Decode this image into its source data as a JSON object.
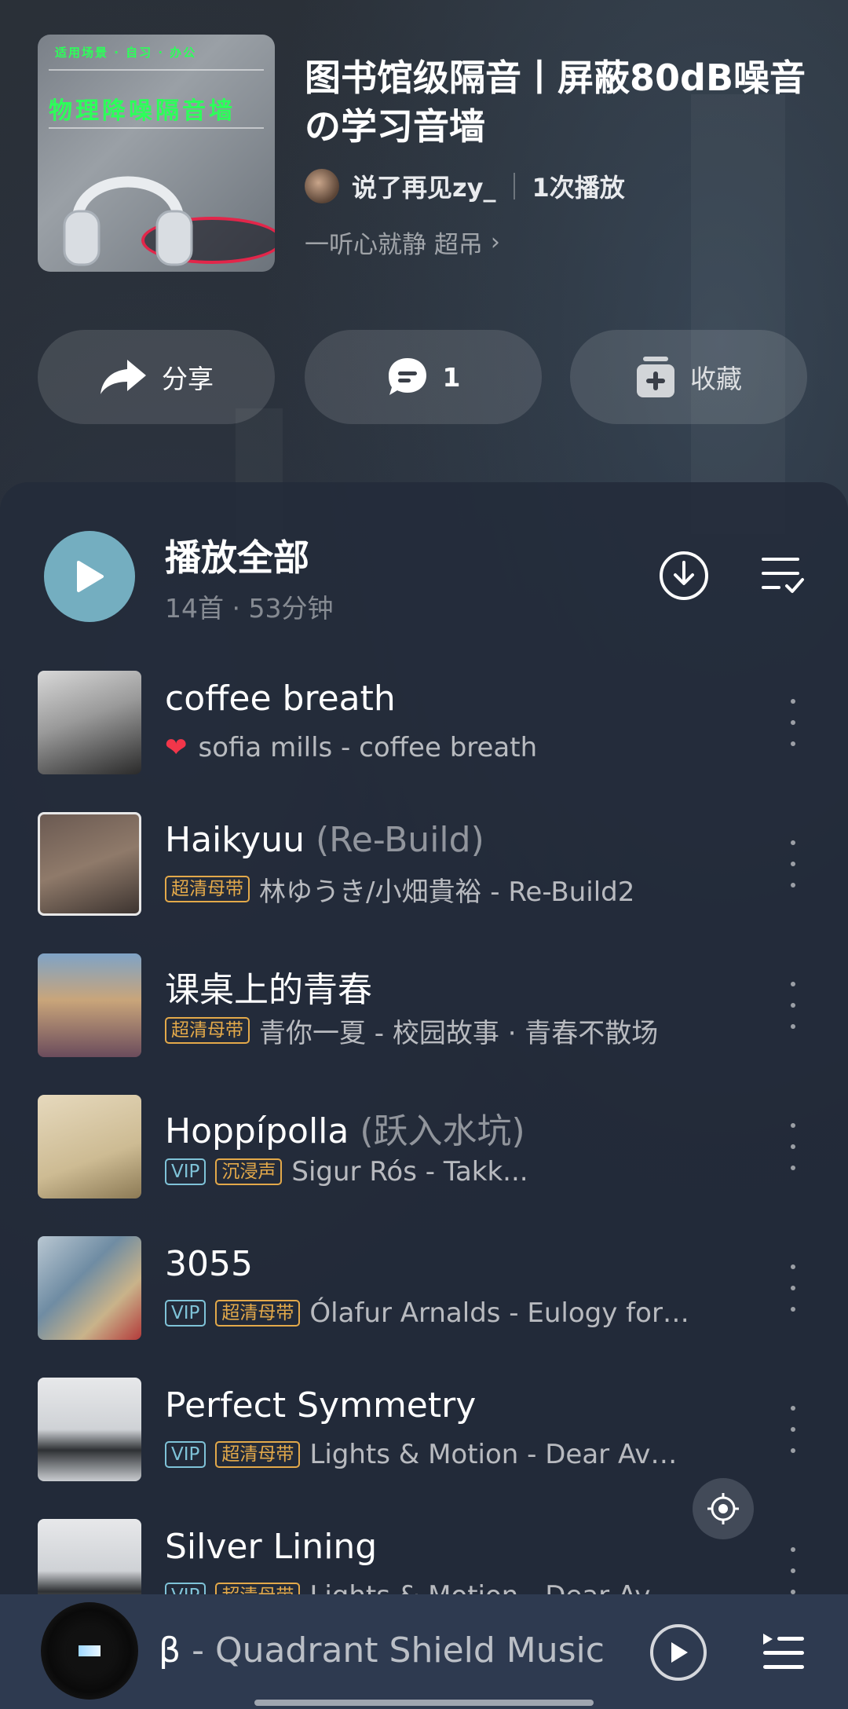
{
  "header": {
    "cover": {
      "line1": "适用场景 · 自习 · 办公",
      "line2": "物理降噪隔音墙"
    },
    "title": "图书馆级隔音丨屏蔽80dB噪音の学习音墙",
    "author": "说了再见zy_",
    "plays": "1次播放",
    "description": "一听心就静 超吊",
    "description_chevron": "›"
  },
  "actions": {
    "share_label": "分享",
    "comment_count": "1",
    "favorite_label": "收藏"
  },
  "playlist": {
    "play_all_label": "播放全部",
    "meta": "14首 · 53分钟"
  },
  "songs": [
    {
      "name": "coffee breath",
      "sub": "",
      "tags": [],
      "liked": true,
      "meta": "sofia mills - coffee breath"
    },
    {
      "name": "Haikyuu ",
      "sub": "(Re-Build)",
      "tags": [
        "超清母带"
      ],
      "meta": "林ゆうき/小畑貴裕 - Re-Build2"
    },
    {
      "name": "课桌上的青春",
      "sub": "",
      "tags": [
        "超清母带"
      ],
      "meta": "青你一夏 - 校园故事 · 青春不散场"
    },
    {
      "name": "Hoppípolla ",
      "sub": "(跃入水坑)",
      "tags": [
        "VIP",
        "沉浸声"
      ],
      "meta": "Sigur Rós - Takk..."
    },
    {
      "name": "3055",
      "sub": "",
      "tags": [
        "VIP",
        "超清母带"
      ],
      "meta": "Ólafur Arnalds - Eulogy for…"
    },
    {
      "name": "Perfect Symmetry",
      "sub": "",
      "tags": [
        "VIP",
        "超清母带"
      ],
      "meta": "Lights & Motion - Dear Av…"
    },
    {
      "name": "Silver Lining",
      "sub": "",
      "tags": [
        "VIP",
        "超清母带"
      ],
      "meta": "Lights & Motion - Dear Av…"
    }
  ],
  "player": {
    "track": "β",
    "artist": " - Quadrant Shield Music"
  },
  "icons": {
    "share": "share-icon",
    "comment": "comment-icon",
    "favorite": "add-collection-icon",
    "download": "download-icon",
    "sort": "multi-select-icon",
    "more": "more-vertical-icon",
    "locate": "locate-current-icon",
    "queue": "queue-icon"
  },
  "colors": {
    "accent": "#74aec0",
    "vip": "#7fc3d8",
    "gold_tag": "#e3a94a",
    "heart": "#f2364a",
    "player_bg": "#2e3a50"
  }
}
